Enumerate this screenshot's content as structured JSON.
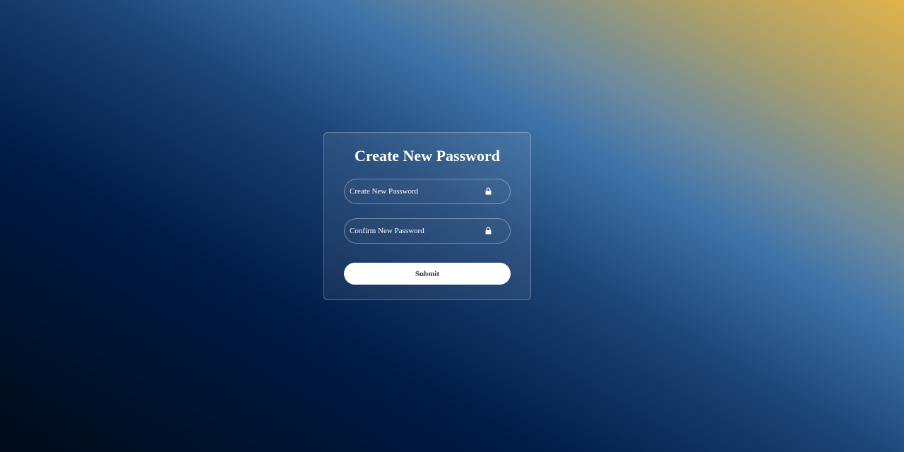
{
  "form": {
    "title": "Create New Password",
    "new_password": {
      "placeholder": "Create New Password",
      "value": "",
      "icon": "lock-icon"
    },
    "confirm_password": {
      "placeholder": "Confirm New Password",
      "value": "",
      "icon": "lock-icon"
    },
    "submit_label": "Submit"
  },
  "colors": {
    "text": "#ffffff",
    "button_bg": "#ffffff",
    "button_text": "#333333",
    "gradient_dark": "#000a17",
    "gradient_blue": "#3f73a8",
    "gradient_gold": "#e0b34b"
  }
}
